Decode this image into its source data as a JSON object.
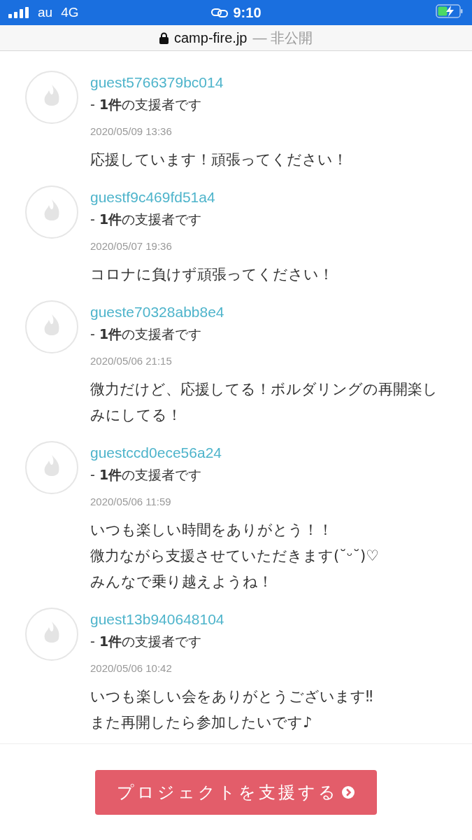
{
  "status_bar": {
    "carrier": "au",
    "network": "4G",
    "time": "9:10",
    "charging": true
  },
  "address_bar": {
    "domain": "camp-fire.jp",
    "suffix": "— 非公開"
  },
  "comments": [
    {
      "user": "guest5766379bc014",
      "support": "- **1件**の支援者です",
      "date": "2020/05/09 13:36",
      "lines": [
        "応援しています！頑張ってください！"
      ]
    },
    {
      "user": "guestf9c469fd51a4",
      "support": "- **1件**の支援者です",
      "date": "2020/05/07 19:36",
      "lines": [
        "コロナに負けず頑張ってください！"
      ]
    },
    {
      "user": "gueste70328abb8e4",
      "support": "- **1件**の支援者です",
      "date": "2020/05/06 21:15",
      "lines": [
        "微力だけど、応援してる！ボルダリングの再開楽しみにしてる！"
      ]
    },
    {
      "user": "guestccd0ece56a24",
      "support": "- **1件**の支援者です",
      "date": "2020/05/06 11:59",
      "lines": [
        "いつも楽しい時間をありがとう！！",
        "微力ながら支援させていただきます(˘ᵕ˘)♡",
        "みんなで乗り越えようね！"
      ]
    },
    {
      "user": "guest13b940648104",
      "support": "- **1件**の支援者です",
      "date": "2020/05/06 10:42",
      "lines": [
        "いつも楽しい会をありがとうございます‼︎",
        "また再開したら参加したいです♪"
      ]
    }
  ],
  "footer": {
    "button": "プロジェクトを支援する"
  }
}
